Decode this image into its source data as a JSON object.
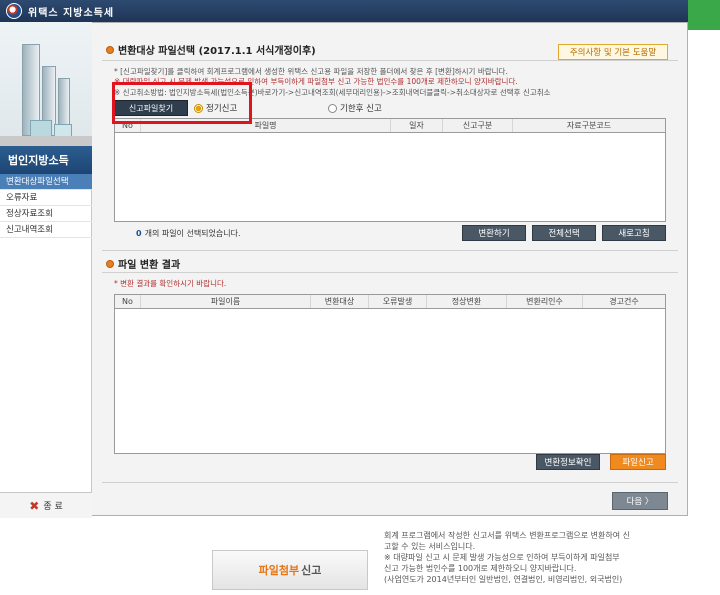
{
  "window": {
    "title": "위택스 지방소득세"
  },
  "sidebar": {
    "heading": "법인지방소득",
    "items": [
      {
        "label": "변환대상파일선택",
        "active": true
      },
      {
        "label": "오류자료",
        "active": false
      },
      {
        "label": "정상자료조회",
        "active": false
      },
      {
        "label": "신고내역조회",
        "active": false
      }
    ],
    "exit_label": "종 료"
  },
  "section1": {
    "title": "변환대상 파일선택 (2017.1.1 서식개정이후)",
    "help_button": "주의사항 및 기본 도움말",
    "notices": [
      "* [신고파일찾기]를 클릭하여 회계프로그램에서 생성한 위택스 신고용 파일을 저장한 폴더에서 찾은 후 [변환]하시기 바랍니다.",
      "※ 대량파일 신고 시 문제 발생 가능성으로 인하여 부득이하게 파일첨부 신고 가능한 법인수를 100개로 제한하오니 양지바랍니다.",
      "※ 신고취소방법: 법인지방소득세(법인소득분)바로가기->신고내역조회(세무대리인용)->조회내역더블클릭->취소대상자로 선택후 신고취소"
    ],
    "find_button": "신고파일찾기",
    "radio_regular": "정기신고",
    "radio_late": "기한후 신고",
    "table_headers": [
      "No",
      "파일명",
      "일자",
      "신고구분",
      "자료구분코드"
    ],
    "selected_count": "0",
    "selected_text": "개의 파일이 선택되었습니다.",
    "buttons": {
      "convert": "변환하기",
      "select_all": "전체선택",
      "refresh": "새로고침"
    }
  },
  "section2": {
    "title": "파일 변환 결과",
    "notice": "* 변환 결과를 확인하시기 바랍니다.",
    "table_headers": [
      "No",
      "파일이름",
      "변환대상",
      "오류발생",
      "정상변환",
      "변환리인수",
      "경고건수"
    ],
    "buttons": {
      "confirm": "변환정보확인",
      "submit": "파일신고"
    }
  },
  "next_button": "다음 〉",
  "bottom": {
    "button_accent": "파일첨부",
    "button_rest": " 신고",
    "lines": [
      "회계 프로그램에서 작성한 신고서를 위택스 변환프로그램으로 변환하여 신",
      "고할 수 있는 서비스입니다.",
      "※ 대량파일 신고 시 문제 발생 가능성으로 인하여 부득이하게 파일첨부",
      "   신고 가능한 법인수를 100개로 제한하오니 양지바랍니다.",
      "(사업연도가 2014년부터인 일반법인, 연결법인, 비영리법인, 외국법인)"
    ]
  },
  "colors": {
    "accent": "#e67e22",
    "primary": "#1d4574",
    "highlight": "#e0141e"
  }
}
